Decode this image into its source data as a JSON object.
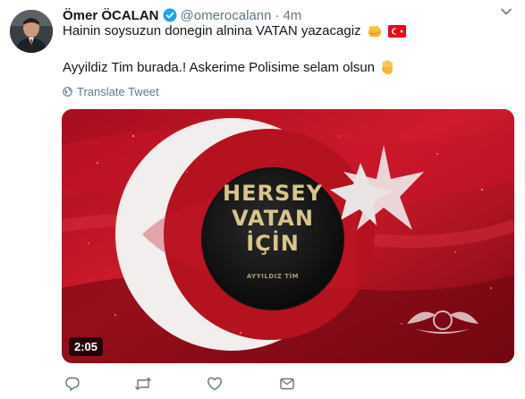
{
  "tweet": {
    "author_name": "Ömer ÖCALAN",
    "handle": "@omerocalann",
    "separator": "·",
    "time": "4m",
    "text_line1": "Hainin soysuzun donegin alnina VATAN yazacagiz",
    "text_line2": "Ayyildiz Tim burada.! Askerime Polisime selam olsun",
    "translate_label": "Translate Tweet"
  },
  "media": {
    "overlay_line1": "HERSEY",
    "overlay_line2": "VATAN",
    "overlay_line3": "İÇİN",
    "overlay_small": "AYYILDIZ TİM",
    "duration": "2:05"
  },
  "icons": {
    "verified": "verified-badge-icon",
    "chevron": "chevron-down-icon",
    "fist_emoji": "fist-emoji-icon",
    "flag_emoji": "turkey-flag-emoji-icon",
    "hand_emoji": "raised-hand-emoji-icon",
    "globe": "globe-icon",
    "reply": "reply-icon",
    "retweet": "retweet-icon",
    "like": "heart-icon",
    "dm": "envelope-icon"
  },
  "colors": {
    "verified_blue": "#1da1f2",
    "secondary_text": "#657786",
    "flag_red": "#c8102e"
  }
}
